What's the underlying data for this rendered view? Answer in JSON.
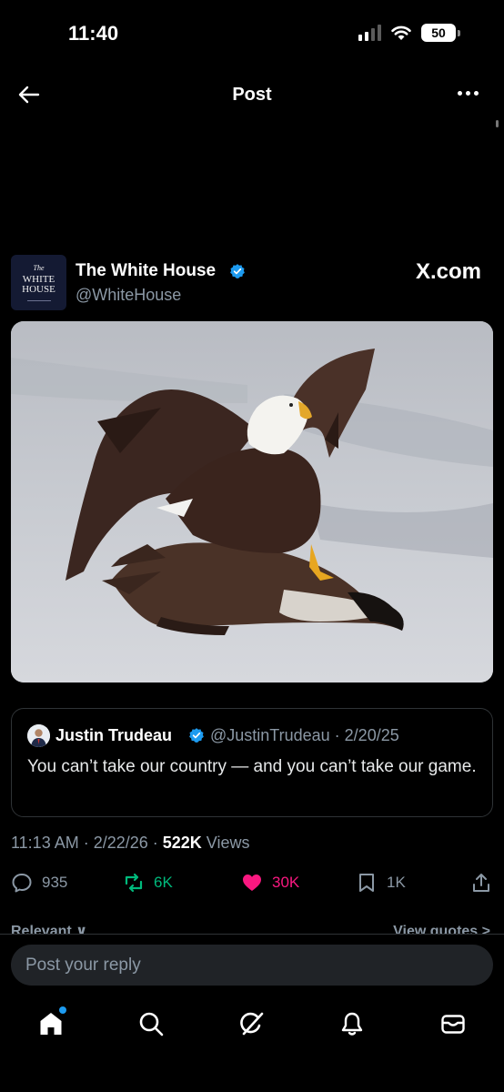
{
  "status_bar": {
    "time": "11:40",
    "battery": "50"
  },
  "nav": {
    "title": "Post",
    "back_icon": "arrow-left-icon",
    "more_icon": "more-horizontal-icon"
  },
  "post": {
    "author_name": "The White House",
    "author_handle": "@WhiteHouse",
    "avatar_lines": [
      "The",
      "WHITE",
      "HOUSE"
    ],
    "watermark": "X.com",
    "image": "bald eagle standing on a goose on ice",
    "quote": {
      "name": "Justin Trudeau",
      "handle_date": "@JustinTrudeau · 2/20/25",
      "text": "You can’t take our country — and you can’t take our game."
    },
    "meta": {
      "time_date": "11:13 AM · 2/22/26 · ",
      "views_count": "522K",
      "views_label": " Views"
    },
    "actions": {
      "replies": "935",
      "reposts": "6K",
      "likes": "30K",
      "bookmarks": "1K"
    },
    "peek": {
      "left": "Relevant ∨",
      "right": "View quotes >"
    }
  },
  "reply": {
    "placeholder": "Post your reply"
  },
  "colors": {
    "verified": "#1d9bf0",
    "repost": "#00ba7c",
    "like": "#f91880",
    "secondary_text": "#8b98a5",
    "background": "#000000"
  },
  "tabs": [
    {
      "name": "home",
      "icon": "home-icon"
    },
    {
      "name": "search",
      "icon": "search-icon"
    },
    {
      "name": "grok",
      "icon": "grok-icon"
    },
    {
      "name": "notifications",
      "icon": "bell-icon"
    },
    {
      "name": "messages",
      "icon": "mail-icon"
    }
  ]
}
